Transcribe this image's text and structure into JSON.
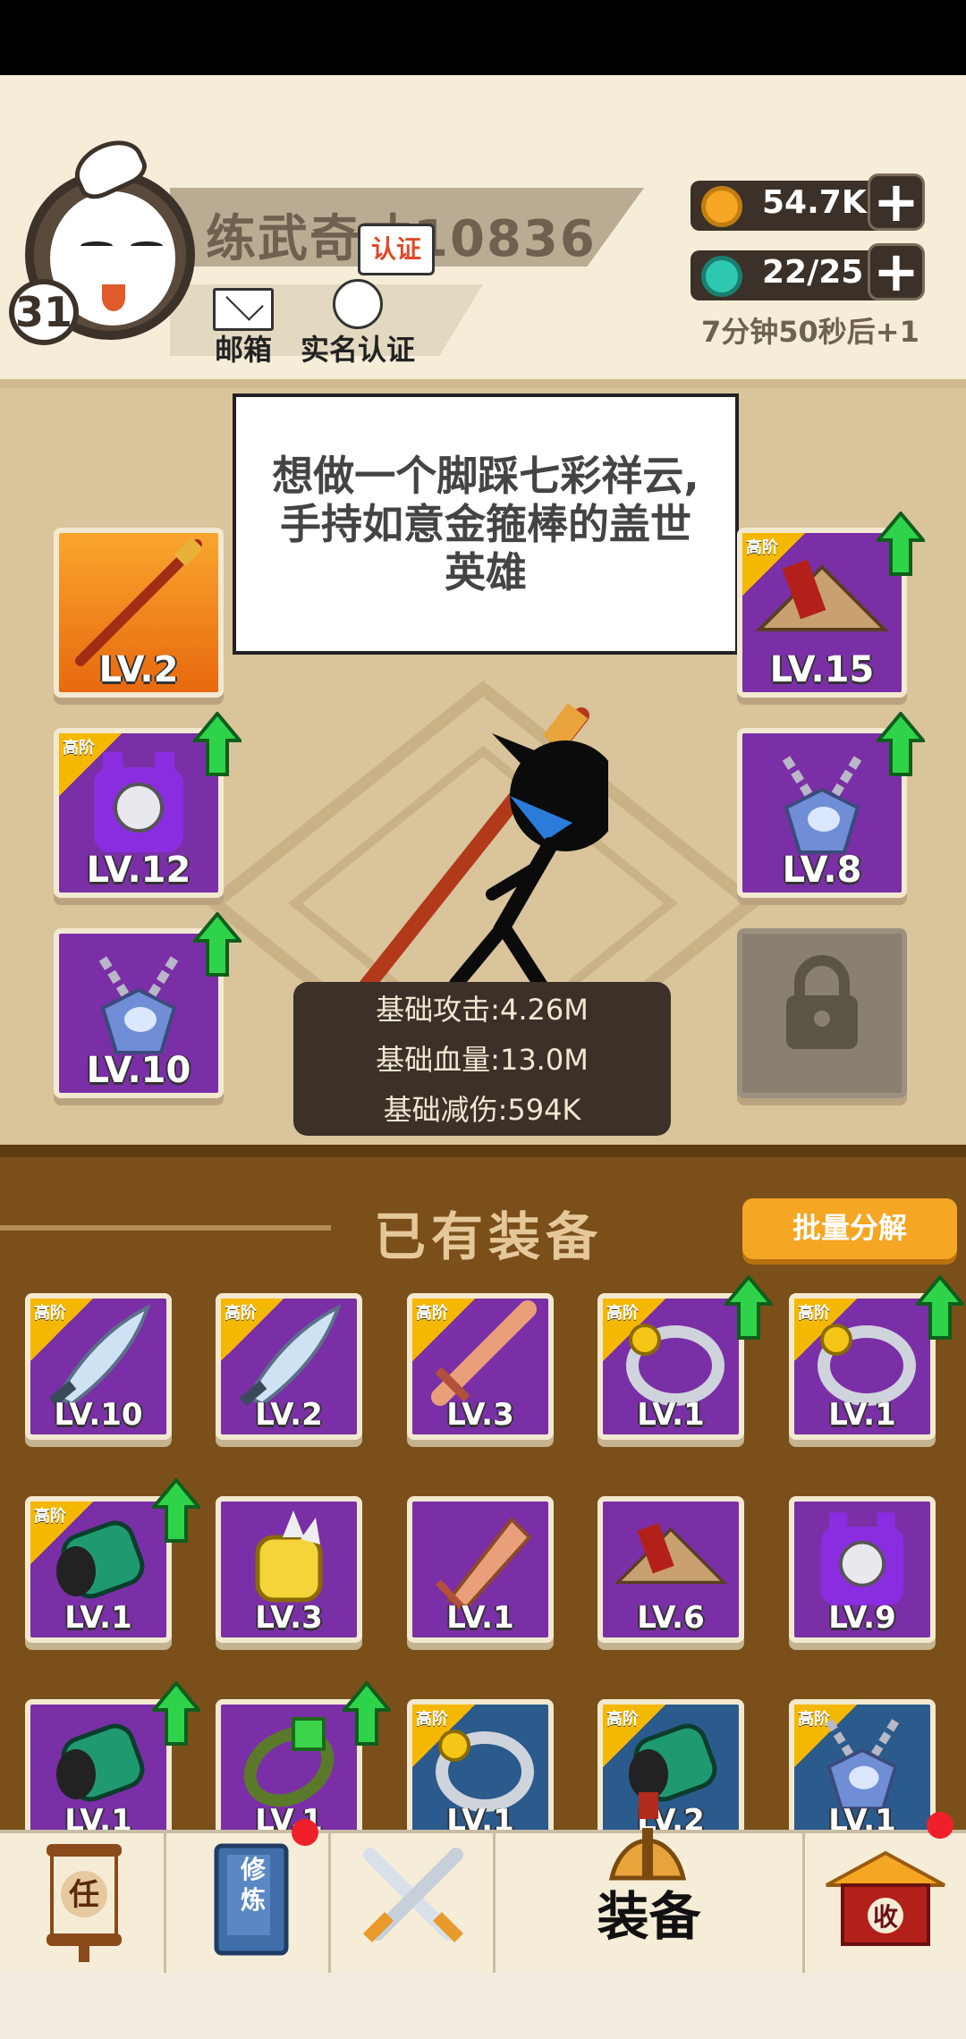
{
  "player": {
    "name": "练武奇才10836",
    "level": "31",
    "mail_label": "邮箱",
    "verify_label": "实名认证",
    "verify_tag": "认证"
  },
  "resources": {
    "coins": "54.7K",
    "gems": "22/25",
    "gem_timer": "7分钟50秒后+1"
  },
  "dialog": "想做一个脚踩七彩祥云,手持如意金箍棒的盖世英雄",
  "equipped": {
    "left": [
      {
        "item": "staff",
        "level": "LV.2",
        "tier": "",
        "upgrade": false,
        "bg": "orange"
      },
      {
        "item": "armor",
        "level": "LV.12",
        "tier": "高阶",
        "upgrade": true,
        "bg": "purple"
      },
      {
        "item": "necklace",
        "level": "LV.10",
        "tier": "",
        "upgrade": true,
        "bg": "purple"
      }
    ],
    "right": [
      {
        "item": "straw-hat",
        "level": "LV.15",
        "tier": "高阶",
        "upgrade": true,
        "bg": "purple"
      },
      {
        "item": "necklace",
        "level": "LV.8",
        "tier": "",
        "upgrade": true,
        "bg": "purple"
      },
      {
        "item": "locked",
        "level": "",
        "tier": "",
        "upgrade": false,
        "bg": "locked"
      }
    ]
  },
  "stats": {
    "attack": "基础攻击:4.26M",
    "hp": "基础血量:13.0M",
    "defense": "基础减伤:594K"
  },
  "inventory": {
    "title": "已有装备",
    "bulk_button": "批量分解",
    "items": [
      {
        "item": "blade",
        "level": "LV.10",
        "tier": "高阶",
        "upgrade": false,
        "bg": "purple"
      },
      {
        "item": "blade",
        "level": "LV.2",
        "tier": "高阶",
        "upgrade": false,
        "bg": "purple"
      },
      {
        "item": "sword",
        "level": "LV.3",
        "tier": "高阶",
        "upgrade": false,
        "bg": "purple"
      },
      {
        "item": "ring",
        "level": "LV.1",
        "tier": "高阶",
        "upgrade": true,
        "bg": "purple"
      },
      {
        "item": "ring",
        "level": "LV.1",
        "tier": "高阶",
        "upgrade": true,
        "bg": "purple"
      },
      {
        "item": "bracer",
        "level": "LV.1",
        "tier": "高阶",
        "upgrade": true,
        "bg": "purple"
      },
      {
        "item": "gauntlet",
        "level": "LV.3",
        "tier": "",
        "upgrade": false,
        "bg": "purple"
      },
      {
        "item": "broadsword",
        "level": "LV.1",
        "tier": "",
        "upgrade": false,
        "bg": "purple"
      },
      {
        "item": "straw-hat",
        "level": "LV.6",
        "tier": "",
        "upgrade": false,
        "bg": "purple"
      },
      {
        "item": "armor",
        "level": "LV.9",
        "tier": "",
        "upgrade": false,
        "bg": "purple"
      },
      {
        "item": "bracer",
        "level": "LV.1",
        "tier": "",
        "upgrade": true,
        "bg": "purple"
      },
      {
        "item": "bracelet",
        "level": "LV.1",
        "tier": "",
        "upgrade": true,
        "bg": "purple"
      },
      {
        "item": "ring",
        "level": "LV.1",
        "tier": "高阶",
        "upgrade": false,
        "bg": "blue"
      },
      {
        "item": "bracer",
        "level": "LV.2",
        "tier": "高阶",
        "upgrade": false,
        "bg": "blue"
      },
      {
        "item": "necklace",
        "level": "LV.1",
        "tier": "高阶",
        "upgrade": false,
        "bg": "blue"
      }
    ]
  },
  "nav": {
    "tasks_glyph": "任",
    "cultivate_glyph": "修炼",
    "equipment_label": "装备",
    "collect_glyph": "收"
  },
  "colors": {
    "purple_slot": "#7a2fa6",
    "blue_slot": "#2b5a8c",
    "upgrade_green": "#2fd34a",
    "panel_brown": "#7b4f1a",
    "bulk_button": "#f5a623"
  }
}
